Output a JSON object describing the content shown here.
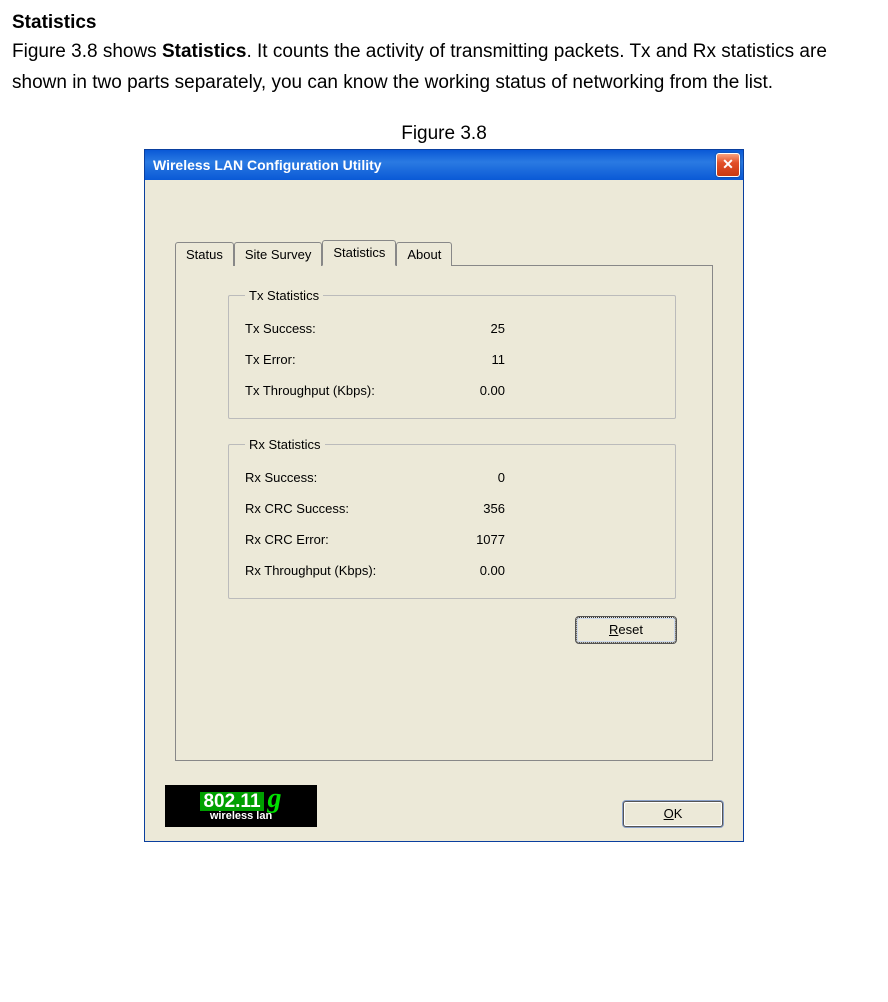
{
  "doc": {
    "heading": "Statistics",
    "para_pre": "Figure 3.8 shows ",
    "para_bold": "Statistics",
    "para_post": ". It counts the activity of transmitting packets. Tx and Rx statistics are shown in two parts separately, you can know the working status of networking from the list.",
    "figure_caption": "Figure 3.8"
  },
  "window": {
    "title": "Wireless LAN Configuration Utility",
    "tabs": {
      "status": "Status",
      "site_survey": "Site Survey",
      "statistics": "Statistics",
      "about": "About"
    },
    "tx_group": {
      "legend": "Tx Statistics",
      "success_label": "Tx Success:",
      "success_value": "25",
      "error_label": "Tx Error:",
      "error_value": "11",
      "throughput_label": "Tx Throughput (Kbps):",
      "throughput_value": "0.00"
    },
    "rx_group": {
      "legend": "Rx Statistics",
      "success_label": "Rx Success:",
      "success_value": "0",
      "crc_success_label": "Rx CRC Success:",
      "crc_success_value": "356",
      "crc_error_label": "Rx CRC Error:",
      "crc_error_value": "1077",
      "throughput_label": "Rx Throughput (Kbps):",
      "throughput_value": "0.00"
    },
    "buttons": {
      "reset_prefix": "R",
      "reset_rest": "eset",
      "ok_prefix": "O",
      "ok_rest": "K"
    },
    "logo": {
      "main": "802.11",
      "g": "g",
      "sub": "wireless lan"
    }
  }
}
